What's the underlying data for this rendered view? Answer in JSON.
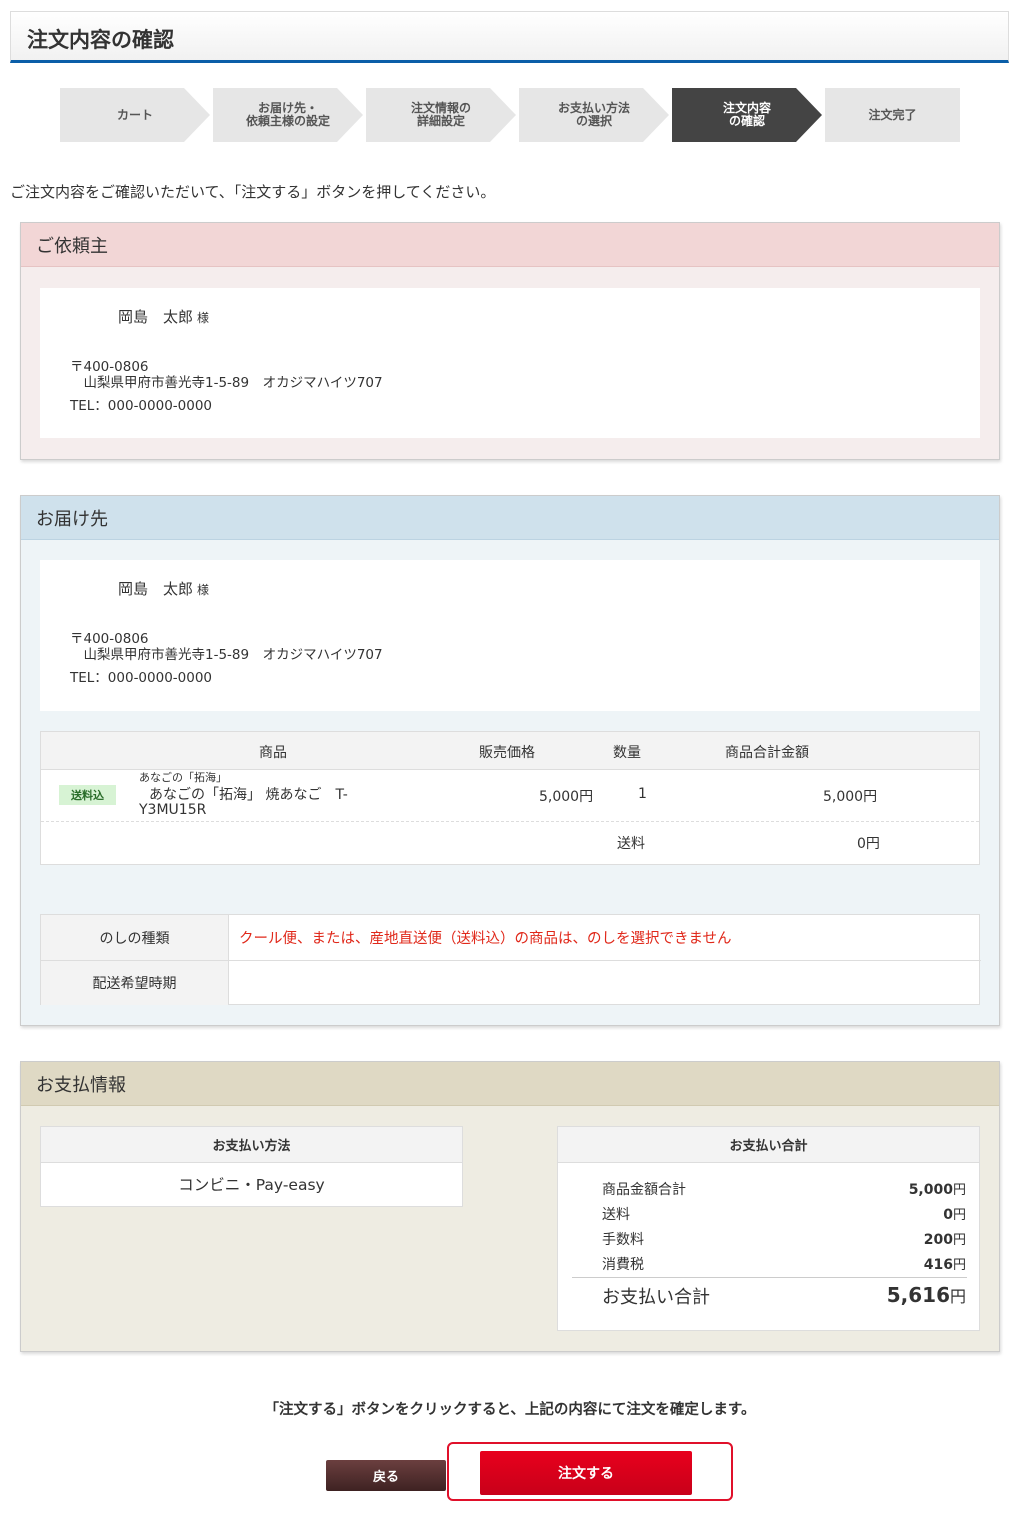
{
  "page": {
    "title": "注文内容の確認",
    "intro": "ご注文内容をご確認いただいて、「注文する」ボタンを押してください。"
  },
  "steps": [
    {
      "label": "カート"
    },
    {
      "label": "お届け先・\n依頼主様の設定"
    },
    {
      "label": "注文情報の\n詳細設定"
    },
    {
      "label": "お支払い方法\nの選択"
    },
    {
      "label": "注文内容\nの確認"
    },
    {
      "label": "注文完了"
    }
  ],
  "requester": {
    "heading": "ご依頼主",
    "name": "岡島　太郎",
    "honorific": "様",
    "postal": "〒400-0806",
    "address": "　山梨県甲府市善光寺1-5-89　オカジマハイツ707",
    "tel": "TEL：000-0000-0000"
  },
  "delivery": {
    "heading": "お届け先",
    "name": "岡島　太郎",
    "honorific": "様",
    "postal": "〒400-0806",
    "address": "　山梨県甲府市善光寺1-5-89　オカジマハイツ707",
    "tel": "TEL：000-0000-0000",
    "table": {
      "headers": {
        "product": "商品",
        "price": "販売価格",
        "qty": "数量",
        "subtotal": "商品合計金額"
      },
      "item": {
        "badge": "送料込",
        "brand": "あなごの「拓海」",
        "name_line1": "あなごの「拓海」 焼あなご　T-",
        "name_line2": "Y3MU15R",
        "price": "5,000円",
        "qty": "1",
        "subtotal": "5,000円"
      },
      "shipping_label": "送料",
      "shipping_value": "0円"
    },
    "options": {
      "noshi_label": "のしの種類",
      "noshi_value": "クール便、または、産地直送便（送料込）の商品は、のしを選択できません",
      "timing_label": "配送希望時期",
      "timing_value": ""
    }
  },
  "payment": {
    "heading": "お支払情報",
    "method_title": "お支払い方法",
    "method_value": "コンビニ・Pay-easy",
    "total_title": "お支払い合計",
    "rows": [
      {
        "label": "商品金額合計",
        "value": "5,000",
        "unit": "円"
      },
      {
        "label": "送料",
        "value": "0",
        "unit": "円"
      },
      {
        "label": "手数料",
        "value": "200",
        "unit": "円"
      },
      {
        "label": "消費税",
        "value": "416",
        "unit": "円"
      }
    ],
    "grand_label": "お支払い合計",
    "grand_value": "5,616",
    "grand_unit": "円"
  },
  "footer": {
    "note": "「注文する」ボタンをクリックすると、上記の内容にて注文を確定します。",
    "back_label": "戻る",
    "order_label": "注文する"
  },
  "colors": {
    "accent": "#0a5ea8",
    "order": "#e8001c",
    "requester_bg": "#f5eded",
    "delivery_bg": "#eef4f7",
    "payment_bg": "#eeece2"
  }
}
